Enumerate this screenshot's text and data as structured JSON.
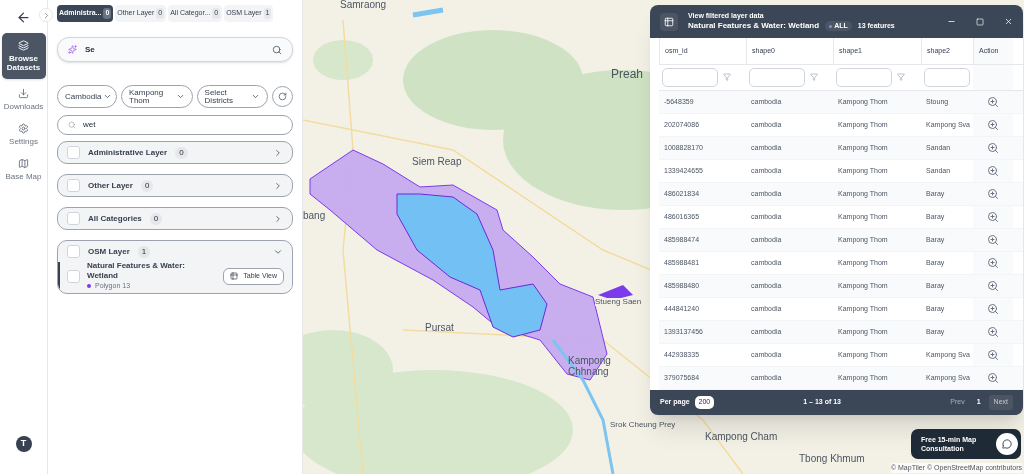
{
  "rail": {
    "items": [
      {
        "label": "Browse Datasets",
        "kind": "layers",
        "selected": true
      },
      {
        "label": "Downloads",
        "kind": "download",
        "selected": false
      },
      {
        "label": "Settings",
        "kind": "settings",
        "selected": false
      },
      {
        "label": "Base Map",
        "kind": "map",
        "selected": false
      }
    ],
    "avatar": "T"
  },
  "layer_tabs": [
    {
      "label": "Administra...",
      "count": "0",
      "selected": true
    },
    {
      "label": "Other Layer",
      "count": "0",
      "selected": false
    },
    {
      "label": "All Categor...",
      "count": "0",
      "selected": false
    },
    {
      "label": "OSM Layer",
      "count": "1",
      "selected": false
    }
  ],
  "search": {
    "value": "Se"
  },
  "filters": [
    {
      "label": "Cambodia"
    },
    {
      "label": "Kampong Thom"
    },
    {
      "label": "Select Districts"
    }
  ],
  "layer_search": {
    "value": "wet"
  },
  "layer_groups": [
    {
      "label": "Administrative Layer",
      "count": "0",
      "checked": false,
      "expanded": false
    },
    {
      "label": "Other Layer",
      "count": "0",
      "checked": false,
      "expanded": false
    },
    {
      "label": "All Categories",
      "count": "0",
      "checked": false,
      "expanded": false
    },
    {
      "label": "OSM Layer",
      "count": "1",
      "checked": false,
      "expanded": true,
      "items": [
        {
          "label": "Natural Features & Water: Wetland",
          "detail": "Polygon 13",
          "color": "#7c3aed",
          "checked": false,
          "action": "Table View"
        }
      ]
    }
  ],
  "map": {
    "labels": [
      "Samraong",
      "Preah",
      "Siem Reap",
      "bang",
      "Stueng Saen",
      "Pursat",
      "Kampong",
      "Chhnang",
      "Srok Cheung Prey",
      "Kampong Cham",
      "Tbong Khmum"
    ],
    "attribution": "© MapTiler © OpenStreetMap contributors"
  },
  "table_window": {
    "subtitle": "View filtered layer data",
    "title": "Natural Features & Water: Wetland",
    "badge": "ALL",
    "count": "13 features",
    "columns": [
      "osm_id",
      "shape0",
      "shape1",
      "shape2",
      "Action"
    ],
    "rows": [
      [
        "-5648359",
        "cambodia",
        "Kampong Thom",
        "Stoung"
      ],
      [
        "202074086",
        "cambodia",
        "Kampong Thom",
        "Kampong Sva"
      ],
      [
        "1008828170",
        "cambodia",
        "Kampong Thom",
        "Sandan"
      ],
      [
        "1339424655",
        "cambodia",
        "Kampong Thom",
        "Sandan"
      ],
      [
        "486021834",
        "cambodia",
        "Kampong Thom",
        "Baray"
      ],
      [
        "486016365",
        "cambodia",
        "Kampong Thom",
        "Baray"
      ],
      [
        "485988474",
        "cambodia",
        "Kampong Thom",
        "Baray"
      ],
      [
        "485988481",
        "cambodia",
        "Kampong Thom",
        "Baray"
      ],
      [
        "485988480",
        "cambodia",
        "Kampong Thom",
        "Baray"
      ],
      [
        "444841240",
        "cambodia",
        "Kampong Thom",
        "Baray"
      ],
      [
        "1393137456",
        "cambodia",
        "Kampong Thom",
        "Baray"
      ],
      [
        "442938335",
        "cambodia",
        "Kampong Thom",
        "Kampong Sva"
      ],
      [
        "379075684",
        "cambodia",
        "Kampong Thom",
        "Kampong Sva"
      ]
    ],
    "per_page_label": "Per page",
    "per_page": "200",
    "range": "1 – 13 of 13",
    "prev": "Prev",
    "page": "1",
    "next": "Next"
  },
  "consultation": "Free 15-min Map Consultation"
}
